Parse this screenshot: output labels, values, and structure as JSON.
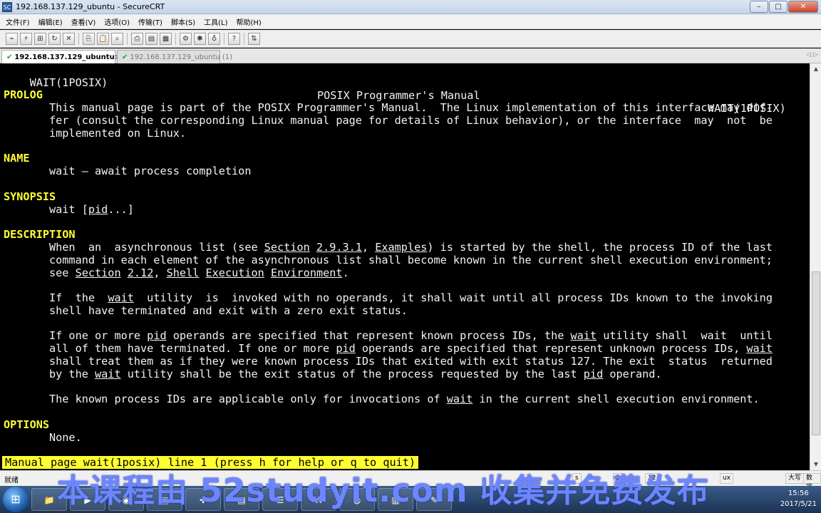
{
  "window": {
    "icon_label": "SC",
    "title": "192.168.137.129_ubuntu - SecureCRT",
    "minimize": "–",
    "maximize": "□",
    "close": "✕"
  },
  "menu": [
    "文件(F)",
    "编辑(E)",
    "查看(V)",
    "选项(O)",
    "传输(T)",
    "脚本(S)",
    "工具(L)",
    "帮助(H)"
  ],
  "toolbar": {
    "groups": [
      [
        "connect-icon",
        "quick-connect-icon",
        "connect-tab-icon",
        "reconnect-icon",
        "disconnect-icon"
      ],
      [
        "copy-icon",
        "paste-icon",
        "find-icon"
      ],
      [
        "print-icon",
        "print-selection-icon",
        "print-screen-icon"
      ],
      [
        "session-options-icon",
        "global-options-icon",
        "keymap-icon"
      ],
      [
        "help-icon"
      ],
      [
        "sftp-icon"
      ]
    ],
    "glyphs": {
      "connect-icon": "⌁",
      "quick-connect-icon": "⚡",
      "connect-tab-icon": "⊞",
      "reconnect-icon": "↻",
      "disconnect-icon": "✕",
      "copy-icon": "⎘",
      "paste-icon": "📋",
      "find-icon": "⌕",
      "print-icon": "⎙",
      "print-selection-icon": "▤",
      "print-screen-icon": "▦",
      "session-options-icon": "⚙",
      "global-options-icon": "✱",
      "keymap-icon": "♁",
      "help-icon": "?",
      "sftp-icon": "⇅"
    }
  },
  "tabs": [
    {
      "label": "192.168.137.129_ubuntu",
      "active": true,
      "close": "×"
    },
    {
      "label": "192.168.137.129_ubuntu",
      "suffix": "(1)",
      "active": false
    }
  ],
  "tab_scroll": "◁ ▷",
  "terminal": {
    "header_left": "WAIT(1POSIX)",
    "header_center": "POSIX Programmer's Manual",
    "header_right": "WAIT(1POSIX)",
    "prolog_title": "PROLOG",
    "prolog_1": "       This manual page is part of the POSIX Programmer's Manual.  The Linux implementation of this interface may dif‐",
    "prolog_2": "       fer (consult the corresponding Linux manual page for details of Linux behavior), or the interface  may  not  be",
    "prolog_3": "       implemented on Linux.",
    "name_title": "NAME",
    "name_1": "       wait — await process completion",
    "synopsis_title": "SYNOPSIS",
    "syn_pre": "       wait [",
    "syn_pid": "pid",
    "syn_post": "...]",
    "description_title": "DESCRIPTION",
    "d1_a": "       When  an  asynchronous list (see ",
    "d1_section": "Section",
    "d1_b": " ",
    "d1_num": "2.9.3.1",
    "d1_c": ", ",
    "d1_examples": "Examples",
    "d1_d": ") is started by the shell, the process ID of the last",
    "d2": "       command in each element of the asynchronous list shall become known in the current shell execution environment;",
    "d3_a": "       see ",
    "d3_section": "Section",
    "d3_b": " ",
    "d3_num": "2.12",
    "d3_c": ", ",
    "d3_shell": "Shell",
    "d3_d": " ",
    "d3_exec": "Execution",
    "d3_e": " ",
    "d3_env": "Environment",
    "d3_f": ".",
    "p2_1a": "       If  the  ",
    "p2_1wait": "wait",
    "p2_1b": "  utility  is  invoked with no operands, it shall wait until all process IDs known to the invoking",
    "p2_2": "       shell have terminated and exit with a zero exit status.",
    "p3_1a": "       If one or more ",
    "p3_1pid": "pid",
    "p3_1b": " operands are specified that represent known process IDs, the ",
    "p3_1wait": "wait",
    "p3_1c": " utility shall  wait  until",
    "p3_2a": "       all of them have terminated. If one or more ",
    "p3_2pid": "pid",
    "p3_2b": " operands are specified that represent unknown process IDs, ",
    "p3_2wait": "wait",
    "p3_3": "       shall treat them as if they were known process IDs that exited with exit status 127. The exit  status  returned",
    "p3_4a": "       by the ",
    "p3_4wait": "wait",
    "p3_4b": " utility shall be the exit status of the process requested by the last ",
    "p3_4pid": "pid",
    "p3_4c": " operand.",
    "p4a": "       The known process IDs are applicable only for invocations of ",
    "p4wait": "wait",
    "p4b": " in the current shell execution environment.",
    "options_title": "OPTIONS",
    "options_1": "       None.",
    "status_line": "Manual page wait(1posix) line 1 (press h for help or q to quit)"
  },
  "scrollbar": {
    "up": "▲",
    "down": "▼"
  },
  "statusbar": {
    "left": "就绪",
    "cells": [
      "s",
      "3",
      "32",
      "ux"
    ],
    "right_1": "大写",
    "right_2": "数字"
  },
  "taskbar": {
    "start": "⊞",
    "apps": [
      "📁",
      "▶",
      "◉",
      "▣",
      "✚",
      "▤",
      "☰",
      "W",
      "◍",
      "▥",
      "✎"
    ],
    "time": "15:56",
    "date": "2017/5/21"
  },
  "watermark": "本课程由 52studyit.com 收集并免费发布"
}
